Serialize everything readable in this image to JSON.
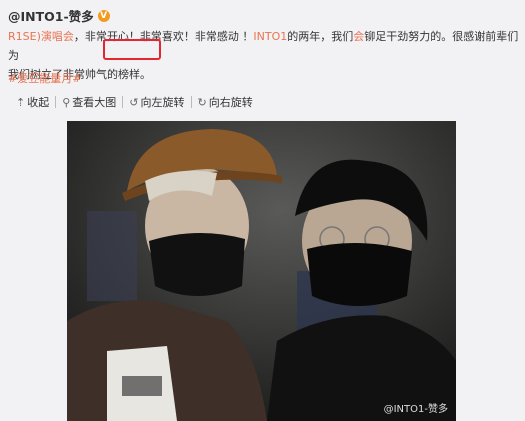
{
  "author": {
    "name": "@INTO1-赞多",
    "badge": "V"
  },
  "post": {
    "link1": "R1SE)演唱会",
    "text1": "，非常开心！非常喜欢！非常感动 ！",
    "link2": "INTO1",
    "text2": "的两年，我们",
    "link3": "会",
    "text3": "铆足干劲努力的。很感谢前辈们为",
    "line2a": "我们树立了非常帅气",
    "line2b": "的榜样。"
  },
  "topic": "#爱豆能量月#",
  "toolbar": {
    "collapse": "收起",
    "view_large": "查看大图",
    "rotate_left": "向左旋转",
    "rotate_right": "向右旋转"
  },
  "watermark": "@INTO1-赞多"
}
